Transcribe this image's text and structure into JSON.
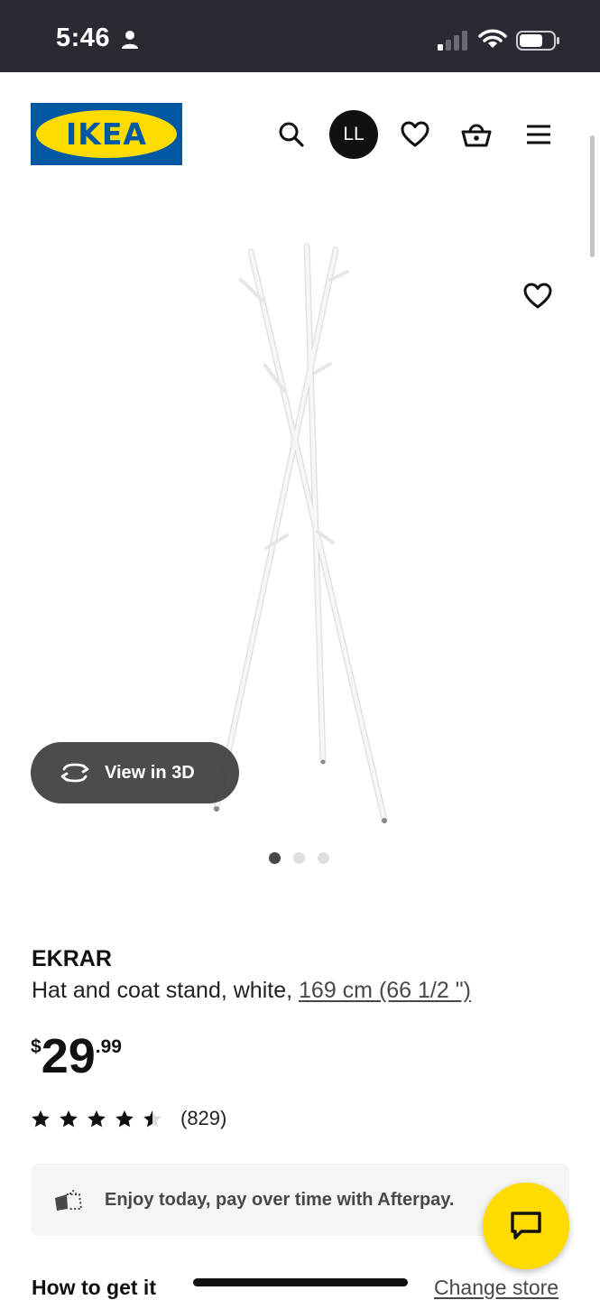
{
  "status_bar": {
    "time": "5:46",
    "icons": [
      "person-icon",
      "cellular-signal-icon",
      "wifi-icon",
      "battery-icon"
    ]
  },
  "header": {
    "logo_text": "IKEA",
    "avatar_initials": "LL",
    "icons": [
      "search-icon",
      "heart-icon",
      "basket-icon",
      "menu-icon"
    ]
  },
  "gallery": {
    "view_3d_label": "View in 3D",
    "image_count": 3,
    "active_image": 1
  },
  "product": {
    "name": "EKRAR",
    "description": "Hat and coat stand, white, ",
    "measurement": "169 cm (66 1/2 \")",
    "price": {
      "currency": "$",
      "integer": "29",
      "decimals": ".99"
    },
    "rating_value": 4.5,
    "rating_max": 5,
    "review_count": "(829)"
  },
  "afterpay": {
    "text": "Enjoy today, pay over time with Afterpay."
  },
  "delivery": {
    "title": "How to get it",
    "change_store_label": "Change store"
  },
  "colors": {
    "ikea_blue": "#0058a3",
    "ikea_yellow": "#ffdb00",
    "status_bar_bg": "#2b2a33"
  }
}
